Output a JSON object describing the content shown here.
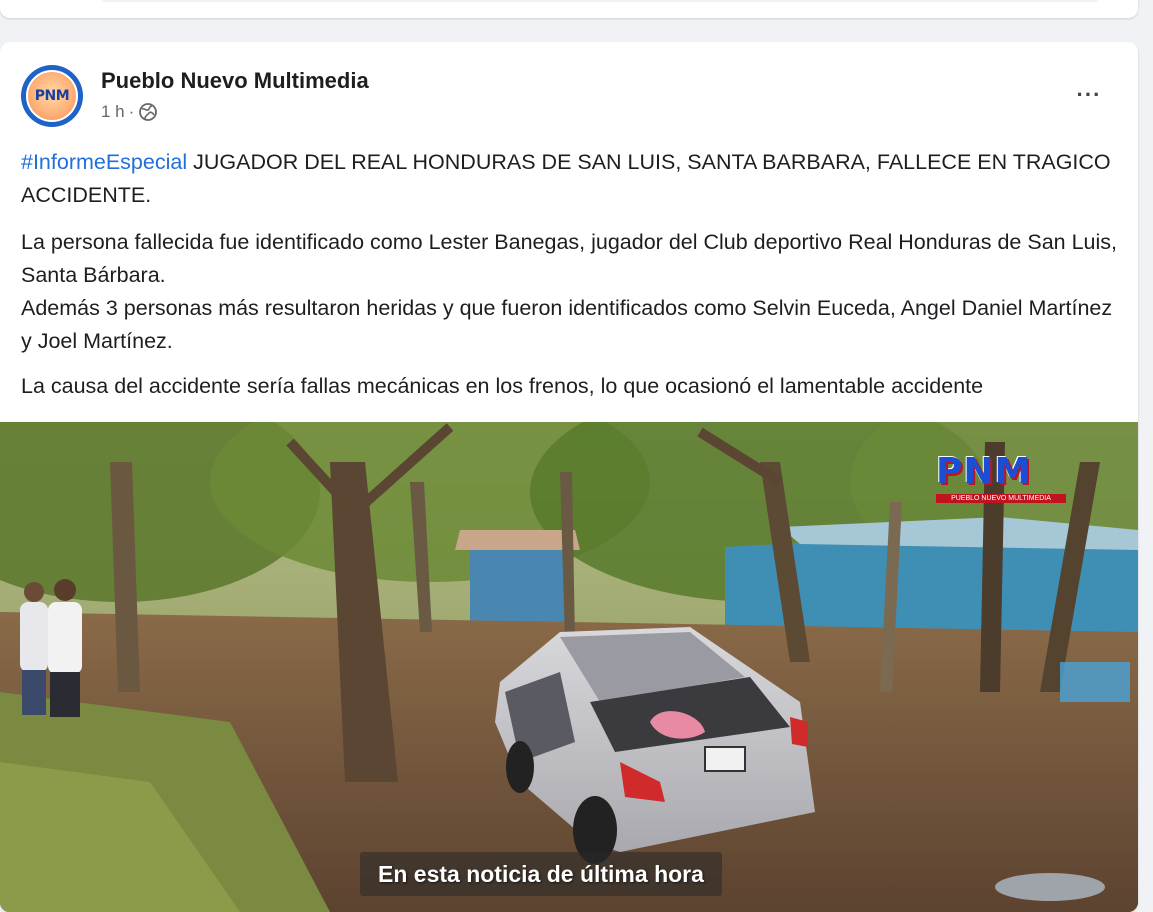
{
  "post": {
    "page_name": "Pueblo Nuevo Multimedia",
    "avatar_text": "PNM",
    "time": "1 h",
    "dot": "·",
    "more_label": "···",
    "hashtag": "#InformeEspecial",
    "headline": " JUGADOR DEL REAL HONDURAS DE SAN LUIS, SANTA BARBARA, FALLECE EN TRAGICO ACCIDENTE.",
    "paragraph_1": "La persona fallecida fue identificado como Lester Banegas, jugador del Club deportivo Real Honduras de San Luis, Santa Bárbara.",
    "paragraph_2": "Además 3 personas más resultaron heridas y que fueron identificados como Selvin Euceda, Angel Daniel Martínez y Joel Martínez.",
    "paragraph_3": "La causa del accidente sería fallas mecánicas en los frenos, lo que ocasionó el lamentable accidente"
  },
  "media": {
    "watermark": "PNM",
    "watermark_sub": "PUEBLO NUEVO MULTIMEDIA",
    "caption": "En esta noticia de última hora"
  },
  "colors": {
    "hashtag": "#216fdb",
    "watermark_blue": "#1b4fd3",
    "watermark_red": "#c1121f"
  },
  "icons": {
    "privacy": "globe-icon",
    "more": "more-options-icon"
  }
}
